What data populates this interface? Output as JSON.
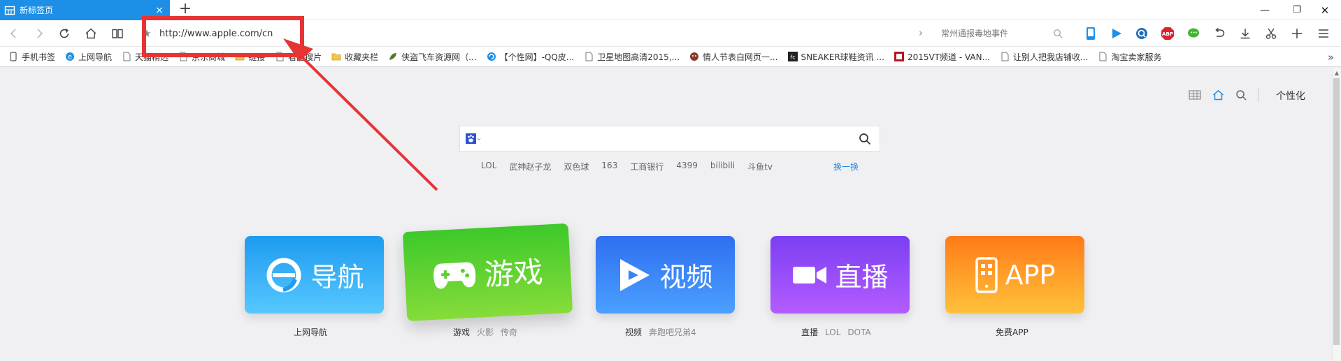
{
  "window": {
    "tab_title": "新标签页",
    "tab_close": "×",
    "new_tab": "+",
    "minimize": "—",
    "restore": "❐",
    "close": "✕"
  },
  "navbar": {
    "url": "http://www.apple.com/cn",
    "search_placeholder": "常州通报毒地事件"
  },
  "bookmarks": [
    {
      "label": "手机书签",
      "icon": "phone-icon"
    },
    {
      "label": "上网导航",
      "icon": "ie-icon"
    },
    {
      "label": "天猫精选",
      "icon": "page-icon"
    },
    {
      "label": "京东商城",
      "icon": "page-icon"
    },
    {
      "label": "链接",
      "icon": "folder-icon"
    },
    {
      "label": "看图搜片",
      "icon": "page-icon"
    },
    {
      "label": "收藏夹栏",
      "icon": "folder-icon"
    },
    {
      "label": "侠盗飞车资源网（...",
      "icon": "leaf-icon"
    },
    {
      "label": "【个性网】-QQ皮...",
      "icon": "swirl-icon"
    },
    {
      "label": "卫星地图高清2015,...",
      "icon": "page-icon"
    },
    {
      "label": "情人节表白网页一...",
      "icon": "face-icon"
    },
    {
      "label": "SNEAKER球鞋资讯 ...",
      "icon": "fc-icon"
    },
    {
      "label": "2015VT频道 - VAN...",
      "icon": "vt-icon"
    },
    {
      "label": "让别人把我店铺收...",
      "icon": "page-icon"
    },
    {
      "label": "淘宝卖家服务",
      "icon": "page-icon"
    }
  ],
  "bookmarks_more": "»",
  "home": {
    "personalize": "个性化",
    "hotwords": [
      "LOL",
      "武神赵子龙",
      "双色球",
      "163",
      "工商银行",
      "4399",
      "bilibili",
      "斗鱼tv"
    ],
    "refresh": "换一换",
    "cards": [
      {
        "title": "导航",
        "caption": "上网导航",
        "subs": [],
        "color_start": "#1e9bf0",
        "color_end": "#56c8ff"
      },
      {
        "title": "游戏",
        "caption": "游戏",
        "subs": [
          "火影",
          "传奇"
        ],
        "color_start": "#3dc92a",
        "color_end": "#86dc3a"
      },
      {
        "title": "视频",
        "caption": "视频",
        "subs": [
          "奔跑吧兄弟4"
        ],
        "color_start": "#2f6ff0",
        "color_end": "#4aa0ff"
      },
      {
        "title": "直播",
        "caption": "直播",
        "subs": [
          "LOL",
          "DOTA"
        ],
        "color_start": "#7b3ff2",
        "color_end": "#b45cff"
      },
      {
        "title": "APP",
        "caption": "免费APP",
        "subs": [],
        "color_start": "#ff7a18",
        "color_end": "#ffc23a"
      }
    ]
  },
  "annotation_color": "#e63434"
}
